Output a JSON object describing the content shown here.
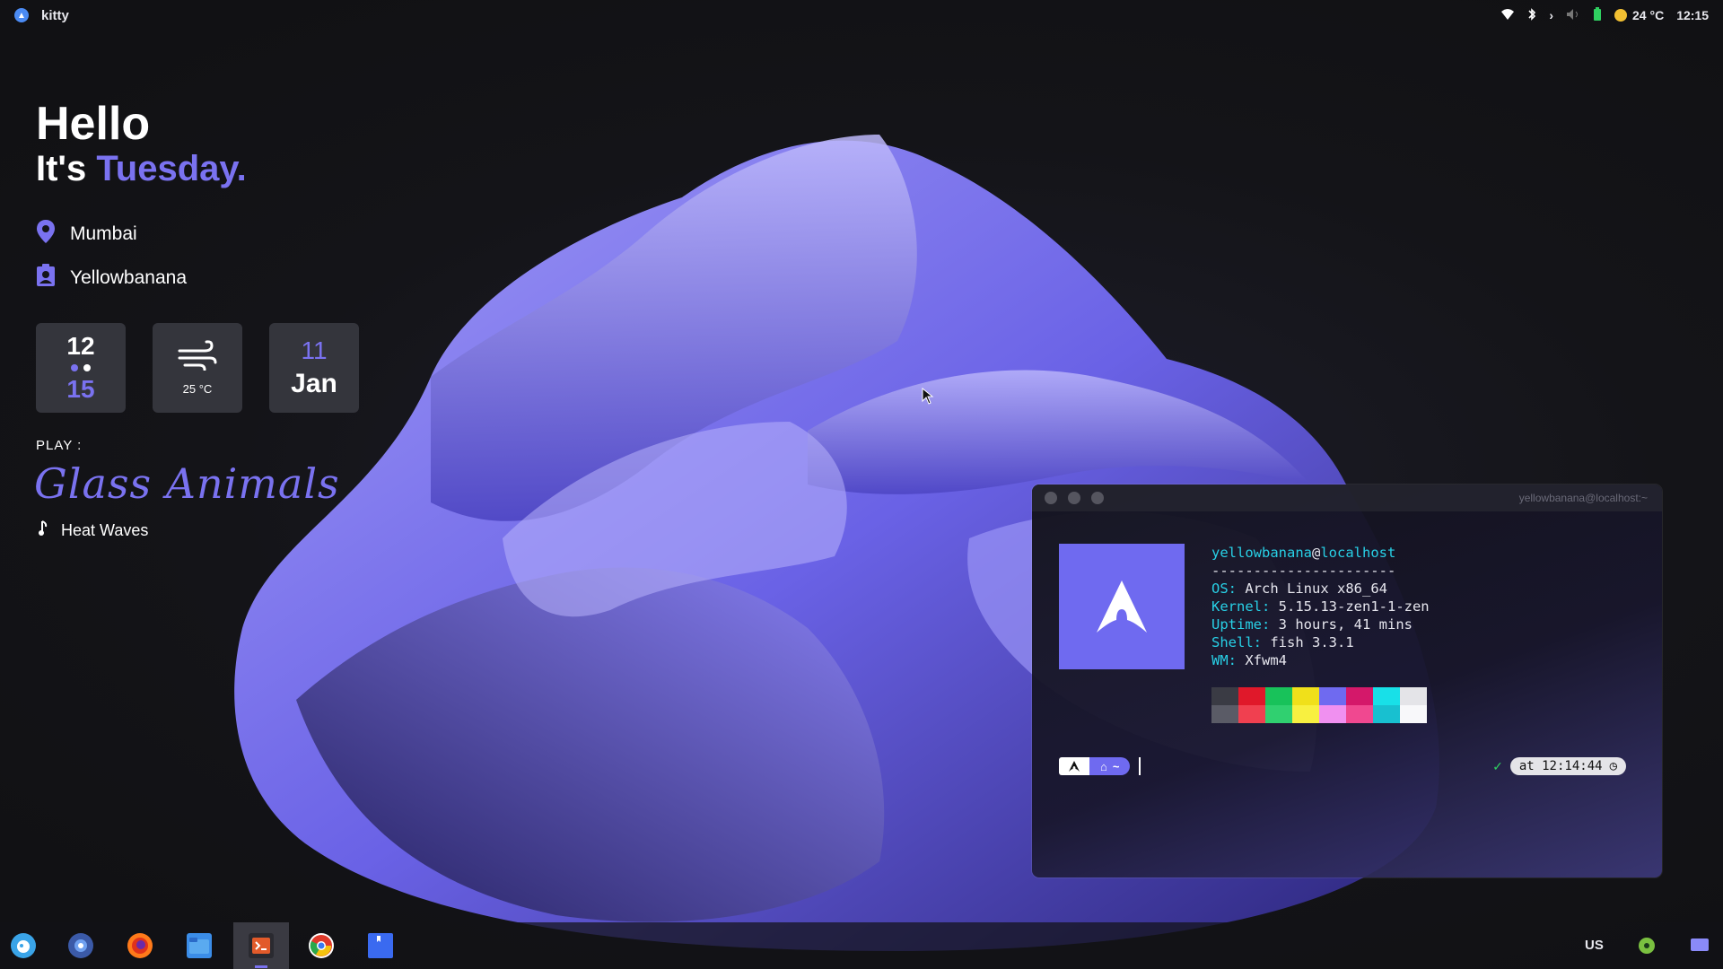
{
  "topbar": {
    "app_name": "kitty",
    "weather": "24 °C",
    "time": "12:15"
  },
  "widget": {
    "greeting": "Hello",
    "its": "It's",
    "day": "Tuesday.",
    "location": "Mumbai",
    "user": "Yellowbanana",
    "clock_hour": "12",
    "clock_min": "15",
    "weather_temp": "25 °C",
    "date_day": "11",
    "date_month": "Jan",
    "play_label": "PLAY :",
    "artist": "Glass Animals",
    "song": "Heat Waves"
  },
  "terminal": {
    "title": "yellowbanana@localhost:~",
    "user": "yellowbanana",
    "at": "@",
    "host": "localhost",
    "separator": "----------------------",
    "fields": [
      {
        "key": "OS",
        "value": "Arch Linux x86_64"
      },
      {
        "key": "Kernel",
        "value": "5.15.13-zen1-1-zen"
      },
      {
        "key": "Uptime",
        "value": "3 hours, 41 mins"
      },
      {
        "key": "Shell",
        "value": "fish 3.3.1"
      },
      {
        "key": "WM",
        "value": "Xfwm4"
      }
    ],
    "prompt_dir": "~",
    "status_check": "✓",
    "prompt_time": "at 12:14:44",
    "palette_top": [
      "#3a3b44",
      "#e0182a",
      "#18c25a",
      "#f0e01a",
      "#6f6af0",
      "#d4186a",
      "#18e0e8",
      "#e4e4e8"
    ],
    "palette_bottom": [
      "#5a5b66",
      "#f04050",
      "#30d070",
      "#f8f040",
      "#f090f0",
      "#f04890",
      "#18c0d0",
      "#f8f8fa"
    ]
  },
  "dock": {
    "items": [
      "whisker-menu-icon",
      "app-finder-icon",
      "firefox-icon",
      "files-icon",
      "terminal-icon",
      "chrome-icon",
      "bookmark-icon"
    ],
    "keyboard_layout": "US"
  },
  "colors": {
    "accent": "#7a72f0",
    "terminal_key": "#28d0e6"
  }
}
